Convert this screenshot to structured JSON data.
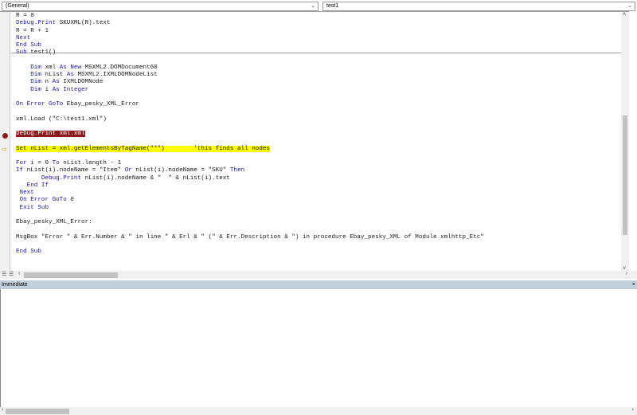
{
  "toolbar": {
    "object_combo": "(General)",
    "procedure_combo": "test1"
  },
  "code_lines": [
    [
      {
        "t": "R = 0",
        "k": "tx"
      }
    ],
    [
      {
        "t": "Debug.Print",
        "k": "kw"
      },
      {
        "t": " SKUXML(R).text",
        "k": "tx"
      }
    ],
    [
      {
        "t": "R = R + 1",
        "k": "tx"
      }
    ],
    [
      {
        "t": "Next",
        "k": "kw"
      }
    ],
    [
      {
        "t": "End Sub",
        "k": "kw"
      }
    ],
    [
      {
        "t": "Sub",
        "k": "kw"
      },
      {
        "t": " test1()",
        "k": "tx"
      }
    ],
    [],
    [
      {
        "t": "    Dim",
        "k": "kw"
      },
      {
        "t": " xml ",
        "k": "tx"
      },
      {
        "t": "As New",
        "k": "kw"
      },
      {
        "t": " MSXML2.DOMDocument60",
        "k": "tx"
      }
    ],
    [
      {
        "t": "    Dim",
        "k": "kw"
      },
      {
        "t": " nList ",
        "k": "tx"
      },
      {
        "t": "As",
        "k": "kw"
      },
      {
        "t": " MSXML2.IXMLDOMNodeList",
        "k": "tx"
      }
    ],
    [
      {
        "t": "    Dim",
        "k": "kw"
      },
      {
        "t": " n ",
        "k": "tx"
      },
      {
        "t": "As",
        "k": "kw"
      },
      {
        "t": " IXMLDOMNode",
        "k": "tx"
      }
    ],
    [
      {
        "t": "    Dim",
        "k": "kw"
      },
      {
        "t": " i ",
        "k": "tx"
      },
      {
        "t": "As Integer",
        "k": "kw"
      }
    ],
    [],
    [
      {
        "t": "On Error GoTo",
        "k": "kw"
      },
      {
        "t": " Ebay_pesky_XML_Error",
        "k": "tx"
      }
    ],
    [],
    [
      {
        "t": "xml.Load (\"C:\\test1.xml\")",
        "k": "tx"
      }
    ],
    [],
    [
      {
        "t": "Debug.Print xml.xml",
        "k": "bp"
      }
    ],
    [],
    [
      {
        "t": "Set nList = xml.getElementsByTagName(\"*\")        'this finds all nodes",
        "k": "ex"
      }
    ],
    [],
    [
      {
        "t": "For",
        "k": "kw"
      },
      {
        "t": " i = 0 ",
        "k": "tx"
      },
      {
        "t": "To",
        "k": "kw"
      },
      {
        "t": " nList.length - 1",
        "k": "tx"
      }
    ],
    [
      {
        "t": "If",
        "k": "kw"
      },
      {
        "t": " nList(i).nodeName = \"Item\" ",
        "k": "tx"
      },
      {
        "t": "Or",
        "k": "kw"
      },
      {
        "t": " nList(i).nodeName = \"SKU\" ",
        "k": "tx"
      },
      {
        "t": "Then",
        "k": "kw"
      }
    ],
    [
      {
        "t": "       Debug.Print",
        "k": "kw"
      },
      {
        "t": " nList(i).nodeName & \"  \" & nList(i).text",
        "k": "tx"
      }
    ],
    [
      {
        "t": "   End If",
        "k": "kw"
      }
    ],
    [
      {
        "t": " Next",
        "k": "kw"
      }
    ],
    [
      {
        "t": " On Error GoTo",
        "k": "kw"
      },
      {
        "t": " 0",
        "k": "tx"
      }
    ],
    [
      {
        "t": " Exit Sub",
        "k": "kw"
      }
    ],
    [],
    [
      {
        "t": "Ebay_pesky_XML_Error:",
        "k": "tx"
      }
    ],
    [],
    [
      {
        "t": "MsgBox \"Error \" & Err.Number & \" in line \" & Erl & \" (\" & Err.Description & \") in procedure Ebay_pesky_XML of Module xmlhttp_Etc\"",
        "k": "tx"
      }
    ],
    [],
    [
      {
        "t": "End Sub",
        "k": "kw"
      }
    ]
  ],
  "immediate": {
    "title": "Immediate",
    "content": ""
  },
  "colors": {
    "keyword": "#1a1a9a",
    "breakpoint": "#8b1a1a",
    "execution": "#ffff00",
    "pane_title": "#c3d0dc"
  }
}
